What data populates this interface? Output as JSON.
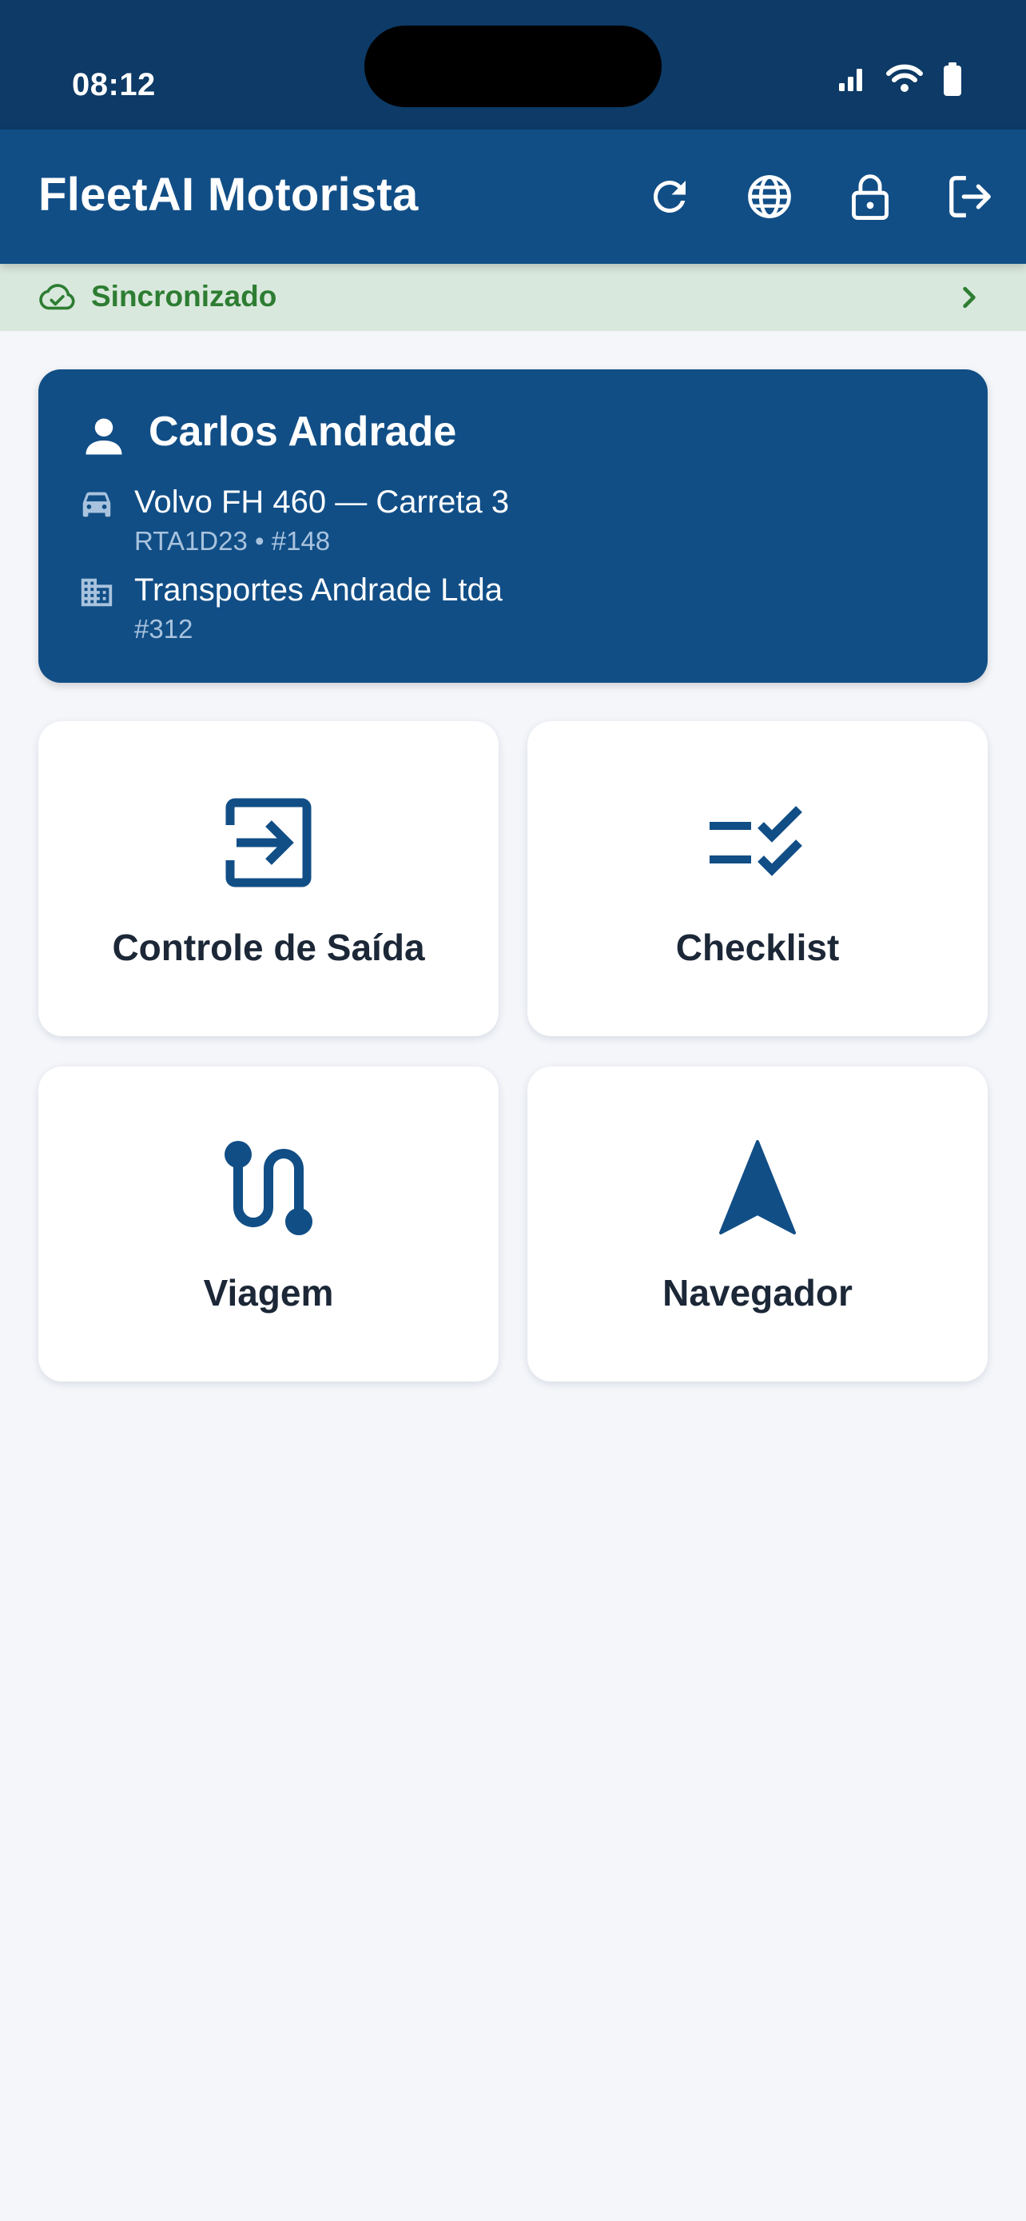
{
  "status_bar": {
    "time": "08:12",
    "icons": [
      "signal-icon",
      "wifi-icon",
      "battery-icon"
    ]
  },
  "app_bar": {
    "title": "FleetAI Motorista",
    "actions": [
      "refresh-icon",
      "globe-icon",
      "lock-icon",
      "logout-icon"
    ]
  },
  "sync": {
    "label": "Sincronizado",
    "icon": "cloud-check-icon",
    "color": "#2d7d32"
  },
  "driver": {
    "name": "Carlos Andrade",
    "vehicle": {
      "title": "Volvo FH 460 — Carreta 3",
      "details": "RTA1D23 • #148"
    },
    "company": {
      "name": "Transportes Andrade Ltda",
      "id": "#312"
    }
  },
  "tiles": [
    {
      "label": "Controle de Saída",
      "icon": "exit-control-icon"
    },
    {
      "label": "Checklist",
      "icon": "checklist-icon"
    },
    {
      "label": "Viagem",
      "icon": "route-icon"
    },
    {
      "label": "Navegador",
      "icon": "navigation-arrow-icon"
    }
  ],
  "colors": {
    "status_bar": "#0d3a66",
    "primary": "#114e86",
    "background": "#f4f6fa",
    "sync_background": "#d9e8dc",
    "tile_text": "#1c2737"
  }
}
